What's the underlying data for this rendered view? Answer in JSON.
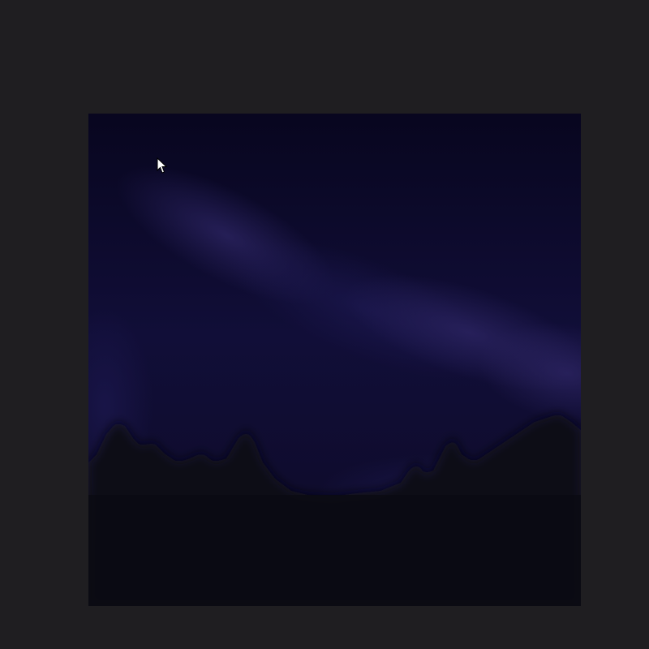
{
  "viewer": {
    "background_color": "#1f1e21"
  },
  "image": {
    "content": "night-sky-over-treeline",
    "colors": {
      "sky_top": "#08061f",
      "sky_mid": "#120f3a",
      "glow": "#2a2360",
      "treeline": "#0c0b18",
      "ground": "#0b0a13"
    }
  },
  "cursor": {
    "icon": "mouse-pointer-icon"
  }
}
